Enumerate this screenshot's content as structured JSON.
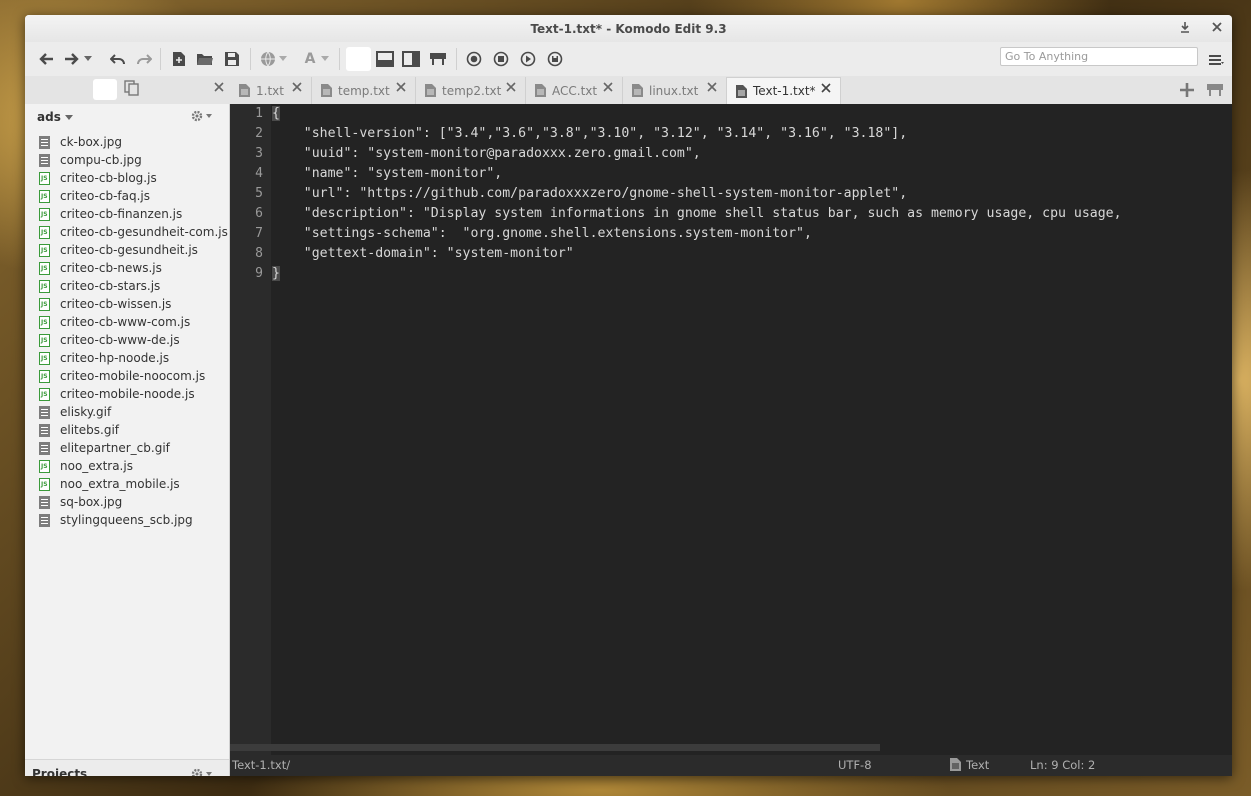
{
  "window": {
    "title": "Text-1.txt* - Komodo Edit 9.3"
  },
  "toolbar": {
    "goto_placeholder": "Go To Anything",
    "font_button_label": "A"
  },
  "tabs": [
    {
      "label": "1.txt",
      "active": false
    },
    {
      "label": "temp.txt",
      "active": false
    },
    {
      "label": "temp2.txt",
      "active": false
    },
    {
      "label": "ACC.txt",
      "active": false
    },
    {
      "label": "linux.txt",
      "active": false
    },
    {
      "label": "Text-1.txt*",
      "active": true
    }
  ],
  "sidebar": {
    "root_label": "ads",
    "files": [
      {
        "name": "ck-box.jpg",
        "type": "image"
      },
      {
        "name": "compu-cb.jpg",
        "type": "image"
      },
      {
        "name": "criteo-cb-blog.js",
        "type": "js"
      },
      {
        "name": "criteo-cb-faq.js",
        "type": "js"
      },
      {
        "name": "criteo-cb-finanzen.js",
        "type": "js"
      },
      {
        "name": "criteo-cb-gesundheit-com.js",
        "type": "js"
      },
      {
        "name": "criteo-cb-gesundheit.js",
        "type": "js"
      },
      {
        "name": "criteo-cb-news.js",
        "type": "js"
      },
      {
        "name": "criteo-cb-stars.js",
        "type": "js"
      },
      {
        "name": "criteo-cb-wissen.js",
        "type": "js"
      },
      {
        "name": "criteo-cb-www-com.js",
        "type": "js"
      },
      {
        "name": "criteo-cb-www-de.js",
        "type": "js"
      },
      {
        "name": "criteo-hp-noode.js",
        "type": "js"
      },
      {
        "name": "criteo-mobile-noocom.js",
        "type": "js"
      },
      {
        "name": "criteo-mobile-noode.js",
        "type": "js"
      },
      {
        "name": "elisky.gif",
        "type": "image"
      },
      {
        "name": "elitebs.gif",
        "type": "image"
      },
      {
        "name": "elitepartner_cb.gif",
        "type": "image"
      },
      {
        "name": "noo_extra.js",
        "type": "js"
      },
      {
        "name": "noo_extra_mobile.js",
        "type": "js"
      },
      {
        "name": "sq-box.jpg",
        "type": "image"
      },
      {
        "name": "stylingqueens_scb.jpg",
        "type": "image"
      }
    ],
    "projects_label": "Projects"
  },
  "editor": {
    "line_numbers": [
      "1",
      "2",
      "3",
      "4",
      "5",
      "6",
      "7",
      "8",
      "9"
    ],
    "lines": [
      "{",
      "    \"shell-version\": [\"3.4\",\"3.6\",\"3.8\",\"3.10\", \"3.12\", \"3.14\", \"3.16\", \"3.18\"],",
      "    \"uuid\": \"system-monitor@paradoxxx.zero.gmail.com\",",
      "    \"name\": \"system-monitor\",",
      "    \"url\": \"https://github.com/paradoxxxzero/gnome-shell-system-monitor-applet\",",
      "    \"description\": \"Display system informations in gnome shell status bar, such as memory usage, cpu usage,",
      "    \"settings-schema\":  \"org.gnome.shell.extensions.system-monitor\",",
      "    \"gettext-domain\": \"system-monitor\"",
      "}"
    ]
  },
  "statusbar": {
    "path": "Text-1.txt/",
    "encoding": "UTF-8",
    "language": "Text",
    "position": "Ln: 9 Col: 2"
  }
}
